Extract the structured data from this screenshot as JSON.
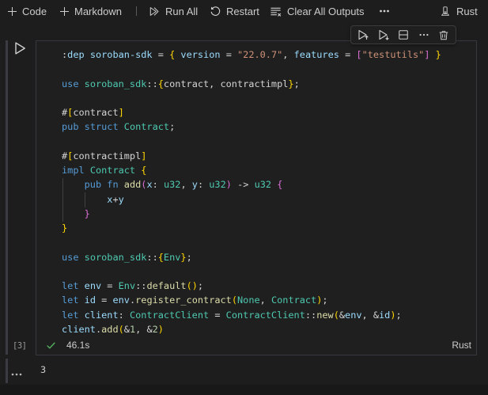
{
  "toolbar": {
    "code_label": "Code",
    "markdown_label": "Markdown",
    "run_all_label": "Run All",
    "restart_label": "Restart",
    "clear_outputs_label": "Clear All Outputs",
    "kernel_label": "Rust"
  },
  "cell_toolbar": {
    "buttons": [
      "execute-above",
      "execute-cell-and-below",
      "split-cell",
      "more-actions",
      "delete-cell"
    ]
  },
  "cell": {
    "execution_count": "[3]",
    "duration": "46.1s",
    "language": "Rust",
    "status": "success"
  },
  "output": {
    "value": "3"
  },
  "colors": {
    "background": "#1d1d1d",
    "cell_background": "#1f1f1f",
    "cell_border": "#37373d",
    "keyword": "#569cd6",
    "variable": "#9cdcfe",
    "string": "#ce9178",
    "type": "#4ec9b0",
    "function": "#dcdcaa",
    "number": "#b5cea8",
    "bracket_level1": "#ffd700",
    "bracket_level2": "#da70d6",
    "success_green": "#55b55f"
  },
  "code": {
    "lines": [
      [
        [
          "pun",
          ":"
        ],
        [
          "var",
          "dep"
        ],
        [
          "pun",
          " "
        ],
        [
          "var",
          "soroban-sdk"
        ],
        [
          "pun",
          " = "
        ],
        [
          "b1",
          "{"
        ],
        [
          "pun",
          " "
        ],
        [
          "var",
          "version"
        ],
        [
          "pun",
          " = "
        ],
        [
          "str",
          "\"22.0.7\""
        ],
        [
          "pun",
          ", "
        ],
        [
          "var",
          "features"
        ],
        [
          "pun",
          " = "
        ],
        [
          "b2",
          "["
        ],
        [
          "str",
          "\"testutils\""
        ],
        [
          "b2",
          "]"
        ],
        [
          "pun",
          " "
        ],
        [
          "b1",
          "}"
        ]
      ],
      [],
      [
        [
          "kw",
          "use"
        ],
        [
          "pun",
          " "
        ],
        [
          "typ",
          "soroban_sdk"
        ],
        [
          "pun",
          "::"
        ],
        [
          "b1",
          "{"
        ],
        [
          "pun",
          "contract, contractimpl"
        ],
        [
          "b1",
          "}"
        ],
        [
          "pun",
          ";"
        ]
      ],
      [],
      [
        [
          "pun",
          "#"
        ],
        [
          "b1",
          "["
        ],
        [
          "pun",
          "contract"
        ],
        [
          "b1",
          "]"
        ]
      ],
      [
        [
          "kw",
          "pub"
        ],
        [
          "pun",
          " "
        ],
        [
          "kw",
          "struct"
        ],
        [
          "pun",
          " "
        ],
        [
          "typ",
          "Contract"
        ],
        [
          "pun",
          ";"
        ]
      ],
      [],
      [
        [
          "pun",
          "#"
        ],
        [
          "b1",
          "["
        ],
        [
          "pun",
          "contractimpl"
        ],
        [
          "b1",
          "]"
        ]
      ],
      [
        [
          "kw",
          "impl"
        ],
        [
          "pun",
          " "
        ],
        [
          "typ",
          "Contract"
        ],
        [
          "pun",
          " "
        ],
        [
          "b1",
          "{"
        ]
      ],
      [
        [
          "pun",
          "    "
        ],
        [
          "kw",
          "pub"
        ],
        [
          "pun",
          " "
        ],
        [
          "kw",
          "fn"
        ],
        [
          "pun",
          " "
        ],
        [
          "fnc",
          "add"
        ],
        [
          "b2",
          "("
        ],
        [
          "var",
          "x"
        ],
        [
          "pun",
          ": "
        ],
        [
          "typ",
          "u32"
        ],
        [
          "pun",
          ", "
        ],
        [
          "var",
          "y"
        ],
        [
          "pun",
          ": "
        ],
        [
          "typ",
          "u32"
        ],
        [
          "b2",
          ")"
        ],
        [
          "pun",
          " -> "
        ],
        [
          "typ",
          "u32"
        ],
        [
          "pun",
          " "
        ],
        [
          "b2",
          "{"
        ]
      ],
      [
        [
          "pun",
          "        "
        ],
        [
          "var",
          "x"
        ],
        [
          "pun",
          "+"
        ],
        [
          "var",
          "y"
        ]
      ],
      [
        [
          "pun",
          "    "
        ],
        [
          "b2",
          "}"
        ]
      ],
      [
        [
          "b1",
          "}"
        ]
      ],
      [],
      [
        [
          "kw",
          "use"
        ],
        [
          "pun",
          " "
        ],
        [
          "typ",
          "soroban_sdk"
        ],
        [
          "pun",
          "::"
        ],
        [
          "b1",
          "{"
        ],
        [
          "typ",
          "Env"
        ],
        [
          "b1",
          "}"
        ],
        [
          "pun",
          ";"
        ]
      ],
      [],
      [
        [
          "kw",
          "let"
        ],
        [
          "pun",
          " "
        ],
        [
          "var",
          "env"
        ],
        [
          "pun",
          " = "
        ],
        [
          "typ",
          "Env"
        ],
        [
          "pun",
          "::"
        ],
        [
          "fnc",
          "default"
        ],
        [
          "b1",
          "()"
        ],
        [
          "pun",
          ";"
        ]
      ],
      [
        [
          "kw",
          "let"
        ],
        [
          "pun",
          " "
        ],
        [
          "var",
          "id"
        ],
        [
          "pun",
          " = "
        ],
        [
          "var",
          "env"
        ],
        [
          "pun",
          "."
        ],
        [
          "fnc",
          "register_contract"
        ],
        [
          "b1",
          "("
        ],
        [
          "typ",
          "None"
        ],
        [
          "pun",
          ", "
        ],
        [
          "typ",
          "Contract"
        ],
        [
          "b1",
          ")"
        ],
        [
          "pun",
          ";"
        ]
      ],
      [
        [
          "kw",
          "let"
        ],
        [
          "pun",
          " "
        ],
        [
          "var",
          "client"
        ],
        [
          "pun",
          ": "
        ],
        [
          "typ",
          "ContractClient"
        ],
        [
          "pun",
          " = "
        ],
        [
          "typ",
          "ContractClient"
        ],
        [
          "pun",
          "::"
        ],
        [
          "fnc",
          "new"
        ],
        [
          "b1",
          "("
        ],
        [
          "pun",
          "&"
        ],
        [
          "var",
          "env"
        ],
        [
          "pun",
          ", &"
        ],
        [
          "var",
          "id"
        ],
        [
          "b1",
          ")"
        ],
        [
          "pun",
          ";"
        ]
      ],
      [
        [
          "var",
          "client"
        ],
        [
          "pun",
          "."
        ],
        [
          "fnc",
          "add"
        ],
        [
          "b1",
          "("
        ],
        [
          "pun",
          "&"
        ],
        [
          "num",
          "1"
        ],
        [
          "pun",
          ", &"
        ],
        [
          "num",
          "2"
        ],
        [
          "b1",
          ")"
        ]
      ]
    ]
  }
}
